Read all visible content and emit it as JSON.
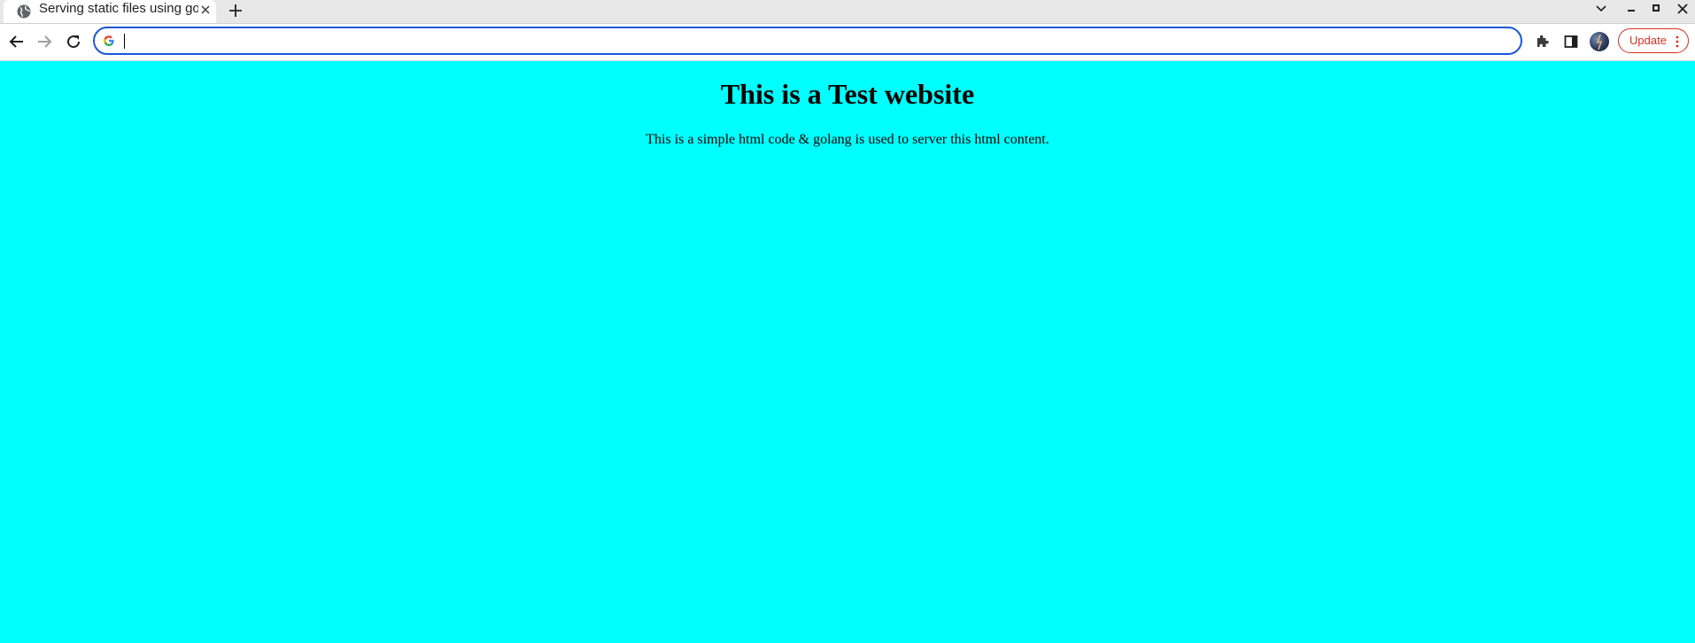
{
  "window": {
    "tab": {
      "title": "Serving static files using go",
      "favicon": "globe-icon",
      "close_icon": "close-icon"
    },
    "new_tab_icon": "plus-icon",
    "controls": [
      "chevron-down-icon",
      "minimize-icon",
      "maximize-icon",
      "close-icon"
    ]
  },
  "toolbar": {
    "back_icon": "arrow-left-icon",
    "forward_icon": "arrow-right-icon",
    "reload_icon": "reload-icon",
    "omnibox": {
      "value": "",
      "engine_icon": "google-g-icon"
    },
    "extensions_icon": "puzzle-icon",
    "side_panel_icon": "side-panel-icon",
    "profile_icon": "avatar",
    "update_label": "Update",
    "menu_icon": "kebab-menu-icon",
    "accent_color": "#1a56db",
    "update_color": "#d93025"
  },
  "page": {
    "background": "#00ffff",
    "heading": "This is a Test website",
    "paragraph": "This is a simple html code & golang is used to server this html content."
  }
}
